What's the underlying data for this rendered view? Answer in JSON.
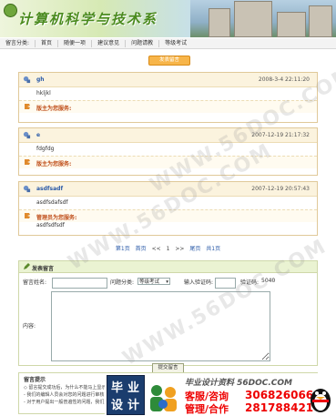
{
  "header": {
    "site_title": "计算机科学与技术系"
  },
  "nav": {
    "label": "留言分类:",
    "items": [
      "首页",
      "随便一项",
      "建议意见",
      "问题请教",
      "等级考试"
    ]
  },
  "top_link": "发表留言",
  "messages": [
    {
      "user": "gh",
      "time": "2008-3-4 22:11:20",
      "content": "hkljkl",
      "reply_label": "版主为您服务:",
      "reply_text": ""
    },
    {
      "user": "e",
      "time": "2007-12-19 21:17:32",
      "content": "fdgfdg",
      "reply_label": "版主为您服务:",
      "reply_text": ""
    },
    {
      "user": "asdfsadf",
      "time": "2007-12-19 20:57:43",
      "content": "asdfsdafsdf",
      "reply_label": "管理员为您服务:",
      "reply_text": "asdfsdfsdf"
    }
  ],
  "pager": {
    "current": "第1页",
    "first": "首页",
    "prev": "<<",
    "page": "1",
    "next": ">>",
    "last": "尾页",
    "total": "共1页"
  },
  "form": {
    "title": "发表留言",
    "name_label": "留言姓名:",
    "name_value": "",
    "category_label": "问题分类:",
    "category_value": "等级考试",
    "verify_label": "输入验证码:",
    "verify_value": "",
    "code_label": "验证码:",
    "code_value": "5040",
    "content_label": "内容:",
    "content_value": "",
    "submit_label": "提交留言"
  },
  "tips": {
    "title": "留言提示",
    "lines": [
      "◇ 留言提交成功后，为什么不能马上显示?",
      "- 我们的编辑人员会对您的问题进行审核，审核通过后才会显示",
      "- 对于用户提出一般普遍性的问题，我们只回复其中的一条"
    ]
  },
  "watermark": "WWW.56DOC.COM",
  "ad": {
    "badge_chars": [
      "毕",
      "业",
      "设",
      "计"
    ],
    "slogan": "毕业设计资料 56DOC.COM",
    "line1_label": "客服/咨询",
    "line1_number": "306826066",
    "line2_label": "管理/合作",
    "line2_number": "281788421"
  },
  "colors": {
    "title_green": "#4a8a1e",
    "link_blue": "#2a5aa8",
    "reply_orange": "#c0501c",
    "ad_red": "#e00000",
    "message_border": "#e0c999"
  }
}
